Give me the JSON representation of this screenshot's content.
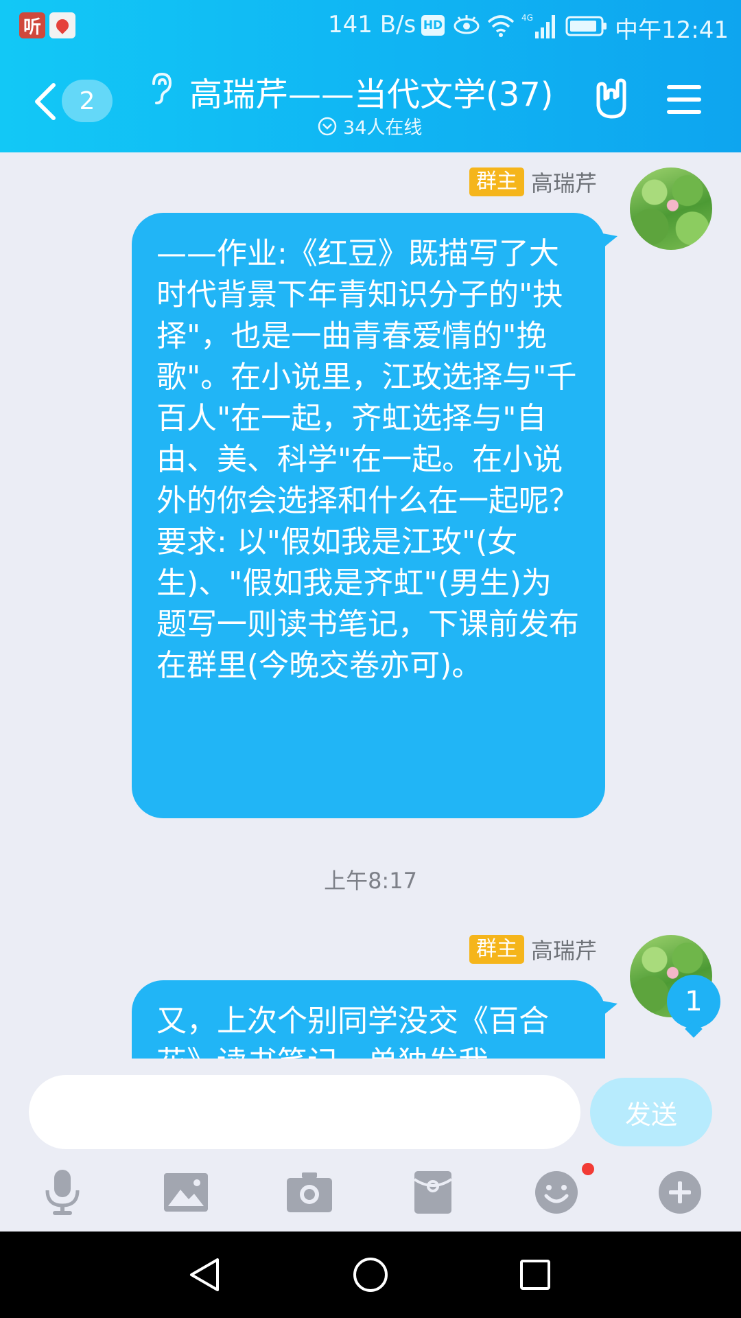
{
  "status_bar": {
    "app_listen": "听",
    "speed": "141 B/s",
    "hd": "HD",
    "network": "4G",
    "time": "中午12:41"
  },
  "header": {
    "unread_count": "2",
    "title": "高瑞芹——当代文学(37)",
    "online_text": "34人在线"
  },
  "messages": [
    {
      "role": "群主",
      "sender": "高瑞芹",
      "text": "——作业:《红豆》既描写了大时代背景下年青知识分子的\"抉择\"，也是一曲青春爱情的\"挽歌\"。在小说里，江玫选择与\"千百人\"在一起，齐虹选择与\"自由、美、科学\"在一起。在小说外的你会选择和什么在一起呢？\n要求: 以\"假如我是江玫\"(女生)、\"假如我是齐虹\"(男生)为题写一则读书笔记，下课前发布在群里(今晚交卷亦可)。"
    },
    {
      "role": "群主",
      "sender": "高瑞芹",
      "text": "又，上次个别同学没交《百合花》读书笔记，单独发我"
    }
  ],
  "time_divider": "上午8:17",
  "floating_badge": "1",
  "input": {
    "value": "",
    "send_label": "发送"
  },
  "toolbar": {
    "icons": [
      "microphone-icon",
      "image-icon",
      "camera-icon",
      "red-packet-icon",
      "emoji-icon",
      "plus-icon"
    ]
  },
  "colors": {
    "header": "#12c8f6",
    "bubble": "#21b5f6",
    "badge": "#f5b51b",
    "background": "#ebedf5"
  }
}
